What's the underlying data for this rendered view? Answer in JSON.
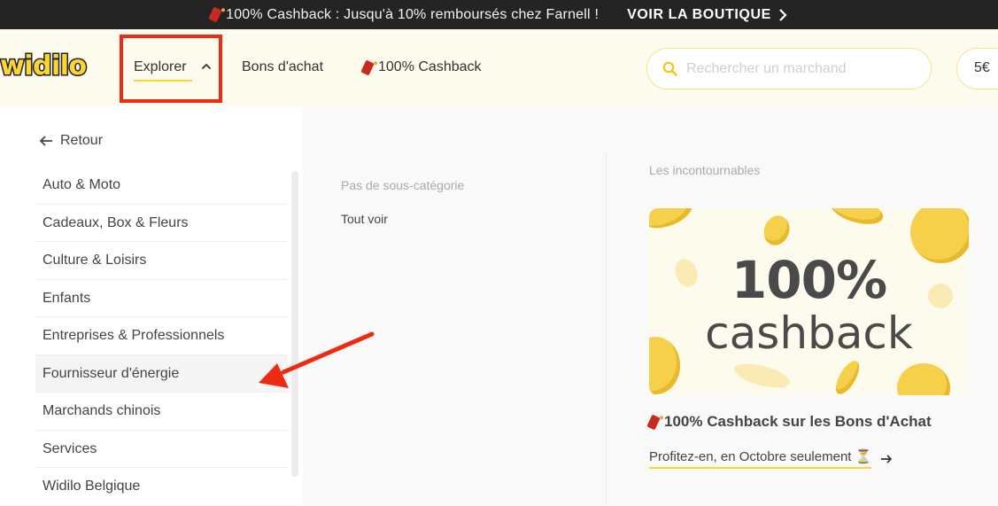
{
  "topbar": {
    "promo_text": "100% Cashback : Jusqu'à 10% remboursés chez Farnell !",
    "cta_label": "VOIR LA BOUTIQUE",
    "cta_icon": "chevron-right-icon"
  },
  "header": {
    "logo_text": "widilo",
    "nav": {
      "explorer_label": "Explorer",
      "explorer_icon": "chevron-up-icon",
      "gift_cards_label": "Bons d'achat",
      "cashback_label": "100% Cashback",
      "cashback_icon": "firecracker-icon"
    },
    "search": {
      "placeholder": "Rechercher un marchand",
      "value": "",
      "icon": "search-icon"
    },
    "balance_label": "5€"
  },
  "menu": {
    "back_label": "Retour",
    "back_icon": "arrow-left-icon",
    "categories": [
      {
        "label": "Auto & Moto",
        "active": false
      },
      {
        "label": "Cadeaux, Box & Fleurs",
        "active": false
      },
      {
        "label": "Culture & Loisirs",
        "active": false
      },
      {
        "label": "Enfants",
        "active": false
      },
      {
        "label": "Entreprises & Professionnels",
        "active": false
      },
      {
        "label": "Fournisseur d'énergie",
        "active": true
      },
      {
        "label": "Marchands chinois",
        "active": false
      },
      {
        "label": "Services",
        "active": false
      },
      {
        "label": "Widilo Belgique",
        "active": false
      }
    ],
    "subcategories": {
      "empty_label": "Pas de sous-catégorie",
      "see_all_label": "Tout voir"
    }
  },
  "featured": {
    "heading": "Les incontournables",
    "banner": {
      "big_text": "100%",
      "small_text": "cashback"
    },
    "title": "100% Cashback sur les Bons d'Achat",
    "link_label": "Profitez-en, en Octobre seulement ⏳",
    "link_icon": "arrow-right-icon"
  },
  "colors": {
    "brand_yellow": "#fcd535",
    "topbar_bg": "#242424",
    "header_bg": "#fdfaee",
    "annotation_red": "#ee2a12"
  }
}
